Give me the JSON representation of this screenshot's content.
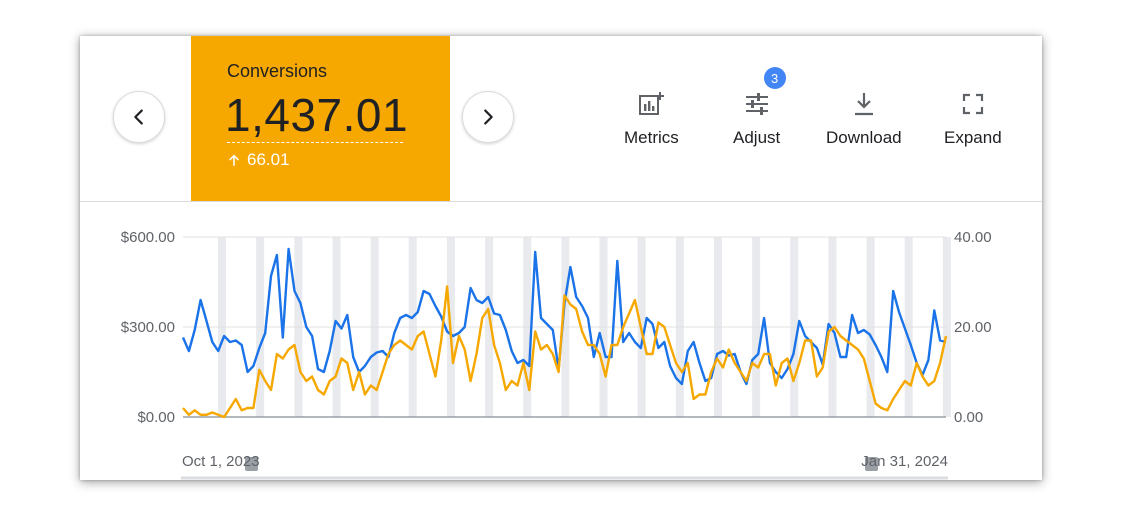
{
  "kpi": {
    "label": "Conversions",
    "value": "1,437.01",
    "change": "66.01",
    "color": "#f6a800"
  },
  "navigation": {
    "prev_icon": "chevron-left-icon",
    "next_icon": "chevron-right-icon"
  },
  "toolbar": {
    "metrics_label": "Metrics",
    "adjust_label": "Adjust",
    "adjust_badge": "3",
    "download_label": "Download",
    "expand_label": "Expand",
    "badge_color": "#4285f4"
  },
  "chart_data": {
    "type": "line",
    "x_range": [
      "Oct 1, 2023",
      "Jan 31, 2024"
    ],
    "left_axis": {
      "ticks": [
        "$600.00",
        "$300.00",
        "$0.00"
      ],
      "ylim": [
        0,
        600
      ]
    },
    "right_axis": {
      "ticks": [
        "40.00",
        "20.00",
        "0.00"
      ],
      "ylim": [
        0,
        40
      ]
    },
    "series": [
      {
        "axis": "left",
        "color": "#1a73e8",
        "values": [
          265,
          220,
          290,
          390,
          320,
          250,
          220,
          270,
          250,
          255,
          240,
          150,
          170,
          230,
          280,
          470,
          540,
          265,
          560,
          420,
          380,
          300,
          270,
          160,
          150,
          220,
          320,
          295,
          340,
          200,
          150,
          170,
          200,
          215,
          220,
          200,
          280,
          330,
          340,
          330,
          350,
          420,
          410,
          370,
          335,
          285,
          270,
          280,
          300,
          430,
          390,
          380,
          400,
          345,
          340,
          290,
          220,
          180,
          190,
          170,
          550,
          330,
          310,
          290,
          160,
          380,
          500,
          400,
          370,
          330,
          200,
          280,
          200,
          200,
          520,
          250,
          280,
          250,
          230,
          330,
          310,
          230,
          250,
          170,
          130,
          110,
          220,
          250,
          180,
          120,
          130,
          210,
          220,
          205,
          210,
          150,
          110,
          190,
          210,
          330,
          180,
          150,
          130,
          160,
          210,
          320,
          270,
          250,
          230,
          175,
          310,
          280,
          200,
          200,
          340,
          280,
          290,
          275,
          240,
          200,
          150,
          420,
          350,
          295,
          240,
          180,
          140,
          190,
          355,
          255,
          250
        ]
      },
      {
        "axis": "right",
        "color": "#f6a800",
        "values": [
          2,
          0.5,
          1.5,
          0.5,
          0.5,
          1,
          0.5,
          0,
          2,
          4,
          1.5,
          2,
          2,
          10.5,
          8,
          6,
          14,
          13,
          15,
          16,
          10,
          8,
          9,
          6,
          5,
          8,
          9,
          13,
          12,
          6,
          10,
          5,
          7,
          6,
          10,
          14,
          16,
          17,
          16,
          15,
          18,
          19,
          14,
          9,
          17,
          29,
          12,
          18,
          15,
          8,
          14,
          22,
          24,
          16,
          12,
          6,
          8,
          7,
          12,
          6,
          19,
          15,
          16,
          14,
          10,
          27,
          25,
          24,
          19,
          16,
          16,
          14,
          9,
          16,
          16,
          20,
          23,
          26,
          20,
          14,
          14,
          21,
          20,
          16,
          12,
          10,
          12,
          4,
          5,
          5,
          10,
          13,
          11,
          15,
          12,
          10,
          8,
          12,
          11,
          14,
          14,
          7,
          12,
          13,
          8,
          12,
          17,
          17,
          9,
          11,
          19,
          20,
          18,
          17,
          16,
          15,
          13,
          8,
          3,
          2,
          1.5,
          4,
          6,
          8,
          7,
          12,
          9,
          7,
          8,
          12,
          18
        ]
      }
    ],
    "shaded_columns": 20,
    "grid": true
  }
}
